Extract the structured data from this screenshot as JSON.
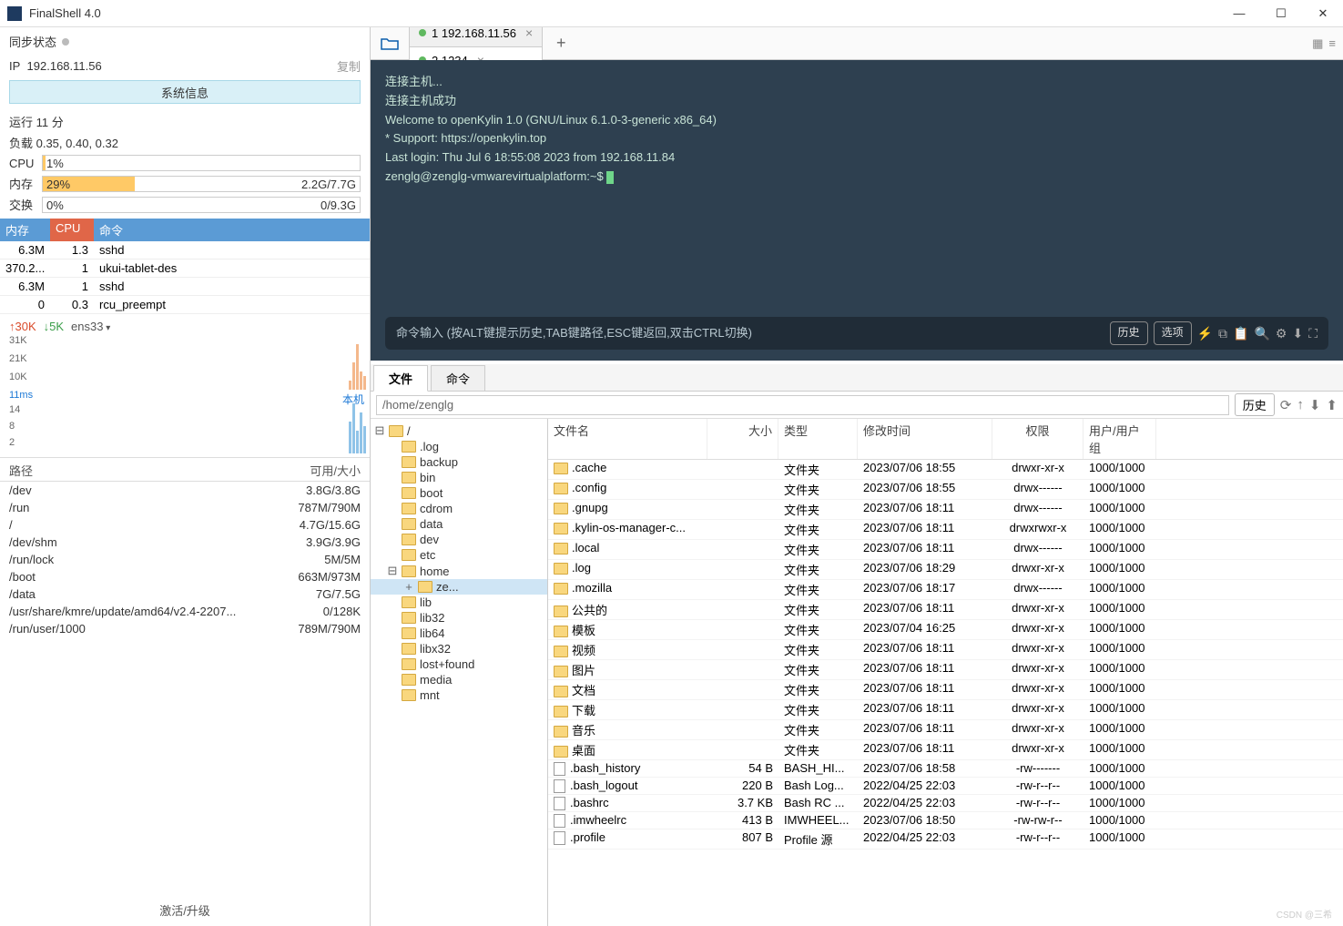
{
  "window": {
    "title": "FinalShell 4.0"
  },
  "left": {
    "sync": "同步状态",
    "ip_label": "IP",
    "ip": "192.168.11.56",
    "copy": "复制",
    "sysinfo_btn": "系统信息",
    "uptime": "运行 11 分",
    "load": "负载 0.35, 0.40, 0.32",
    "cpu": {
      "label": "CPU",
      "pct": "1%",
      "fill": 1
    },
    "mem": {
      "label": "内存",
      "pct": "29%",
      "right": "2.2G/7.7G",
      "fill": 29
    },
    "swap": {
      "label": "交换",
      "pct": "0%",
      "right": "0/9.3G",
      "fill": 0
    },
    "proc_head": {
      "mem": "内存",
      "cpu": "CPU",
      "cmd": "命令"
    },
    "procs": [
      {
        "mem": "6.3M",
        "cpu": "1.3",
        "cmd": "sshd"
      },
      {
        "mem": "370.2...",
        "cpu": "1",
        "cmd": "ukui-tablet-des"
      },
      {
        "mem": "6.3M",
        "cpu": "1",
        "cmd": "sshd"
      },
      {
        "mem": "0",
        "cpu": "0.3",
        "cmd": "rcu_preempt"
      }
    ],
    "net": {
      "up": "↑30K",
      "down": "↓5K",
      "iface": "ens33"
    },
    "chart1_y": [
      "31K",
      "21K",
      "10K"
    ],
    "chart2_y": [
      "11ms",
      "14",
      "8",
      "2"
    ],
    "chart2_label": "本机",
    "disk_head": {
      "path": "路径",
      "size": "可用/大小"
    },
    "disks": [
      {
        "path": "/dev",
        "size": "3.8G/3.8G",
        "fill": 0
      },
      {
        "path": "/run",
        "size": "787M/790M",
        "fill": 0
      },
      {
        "path": "/",
        "size": "4.7G/15.6G",
        "fill": 70
      },
      {
        "path": "/dev/shm",
        "size": "3.9G/3.9G",
        "fill": 0
      },
      {
        "path": "/run/lock",
        "size": "5M/5M",
        "fill": 0
      },
      {
        "path": "/boot",
        "size": "663M/973M",
        "fill": 32
      },
      {
        "path": "/data",
        "size": "7G/7.5G",
        "fill": 7
      },
      {
        "path": "/usr/share/kmre/update/amd64/v2.4-2207...",
        "size": "0/128K",
        "fill": 100
      },
      {
        "path": "/run/user/1000",
        "size": "789M/790M",
        "fill": 0
      }
    ],
    "upgrade": "激活/升级"
  },
  "tabs": [
    {
      "label": "1 192.168.11.56",
      "active": false
    },
    {
      "label": "2 1234",
      "active": true
    }
  ],
  "terminal_lines": [
    "连接主机...",
    "连接主机成功",
    "Welcome to openKylin 1.0 (GNU/Linux 6.1.0-3-generic x86_64)",
    "",
    " * Support:        https://openkylin.top",
    "",
    "Last login: Thu Jul  6 18:55:08 2023 from 192.168.11.84",
    "zenglg@zenglg-vmwarevirtualplatform:~$ "
  ],
  "term_hint": "命令输入 (按ALT键提示历史,TAB键路径,ESC键返回,双击CTRL切换)",
  "term_btns": {
    "history": "历史",
    "options": "选项"
  },
  "btabs": {
    "file": "文件",
    "cmd": "命令"
  },
  "path": "/home/zenglg",
  "path_history": "历史",
  "tree": [
    {
      "lvl": 0,
      "name": "/",
      "open": true
    },
    {
      "lvl": 1,
      "name": ".log"
    },
    {
      "lvl": 1,
      "name": "backup"
    },
    {
      "lvl": 1,
      "name": "bin"
    },
    {
      "lvl": 1,
      "name": "boot"
    },
    {
      "lvl": 1,
      "name": "cdrom"
    },
    {
      "lvl": 1,
      "name": "data"
    },
    {
      "lvl": 1,
      "name": "dev"
    },
    {
      "lvl": 1,
      "name": "etc"
    },
    {
      "lvl": 1,
      "name": "home",
      "open": true
    },
    {
      "lvl": 2,
      "name": "ze...",
      "sel": true,
      "tgl": "+"
    },
    {
      "lvl": 1,
      "name": "lib"
    },
    {
      "lvl": 1,
      "name": "lib32"
    },
    {
      "lvl": 1,
      "name": "lib64"
    },
    {
      "lvl": 1,
      "name": "libx32"
    },
    {
      "lvl": 1,
      "name": "lost+found"
    },
    {
      "lvl": 1,
      "name": "media"
    },
    {
      "lvl": 1,
      "name": "mnt"
    }
  ],
  "fl_head": {
    "name": "文件名",
    "size": "大小",
    "type": "类型",
    "date": "修改时间",
    "perm": "权限",
    "user": "用户/用户组"
  },
  "files": [
    {
      "folder": true,
      "name": ".cache",
      "size": "",
      "type": "文件夹",
      "date": "2023/07/06 18:55",
      "perm": "drwxr-xr-x",
      "user": "1000/1000"
    },
    {
      "folder": true,
      "name": ".config",
      "size": "",
      "type": "文件夹",
      "date": "2023/07/06 18:55",
      "perm": "drwx------",
      "user": "1000/1000"
    },
    {
      "folder": true,
      "name": ".gnupg",
      "size": "",
      "type": "文件夹",
      "date": "2023/07/06 18:11",
      "perm": "drwx------",
      "user": "1000/1000"
    },
    {
      "folder": true,
      "name": ".kylin-os-manager-c...",
      "size": "",
      "type": "文件夹",
      "date": "2023/07/06 18:11",
      "perm": "drwxrwxr-x",
      "user": "1000/1000"
    },
    {
      "folder": true,
      "name": ".local",
      "size": "",
      "type": "文件夹",
      "date": "2023/07/06 18:11",
      "perm": "drwx------",
      "user": "1000/1000"
    },
    {
      "folder": true,
      "name": ".log",
      "size": "",
      "type": "文件夹",
      "date": "2023/07/06 18:29",
      "perm": "drwxr-xr-x",
      "user": "1000/1000"
    },
    {
      "folder": true,
      "name": ".mozilla",
      "size": "",
      "type": "文件夹",
      "date": "2023/07/06 18:17",
      "perm": "drwx------",
      "user": "1000/1000"
    },
    {
      "folder": true,
      "name": "公共的",
      "size": "",
      "type": "文件夹",
      "date": "2023/07/06 18:11",
      "perm": "drwxr-xr-x",
      "user": "1000/1000"
    },
    {
      "folder": true,
      "name": "模板",
      "size": "",
      "type": "文件夹",
      "date": "2023/07/04 16:25",
      "perm": "drwxr-xr-x",
      "user": "1000/1000"
    },
    {
      "folder": true,
      "name": "视频",
      "size": "",
      "type": "文件夹",
      "date": "2023/07/06 18:11",
      "perm": "drwxr-xr-x",
      "user": "1000/1000"
    },
    {
      "folder": true,
      "name": "图片",
      "size": "",
      "type": "文件夹",
      "date": "2023/07/06 18:11",
      "perm": "drwxr-xr-x",
      "user": "1000/1000"
    },
    {
      "folder": true,
      "name": "文档",
      "size": "",
      "type": "文件夹",
      "date": "2023/07/06 18:11",
      "perm": "drwxr-xr-x",
      "user": "1000/1000"
    },
    {
      "folder": true,
      "name": "下载",
      "size": "",
      "type": "文件夹",
      "date": "2023/07/06 18:11",
      "perm": "drwxr-xr-x",
      "user": "1000/1000"
    },
    {
      "folder": true,
      "name": "音乐",
      "size": "",
      "type": "文件夹",
      "date": "2023/07/06 18:11",
      "perm": "drwxr-xr-x",
      "user": "1000/1000"
    },
    {
      "folder": true,
      "name": "桌面",
      "size": "",
      "type": "文件夹",
      "date": "2023/07/06 18:11",
      "perm": "drwxr-xr-x",
      "user": "1000/1000"
    },
    {
      "folder": false,
      "name": ".bash_history",
      "size": "54 B",
      "type": "BASH_HI...",
      "date": "2023/07/06 18:58",
      "perm": "-rw-------",
      "user": "1000/1000"
    },
    {
      "folder": false,
      "name": ".bash_logout",
      "size": "220 B",
      "type": "Bash Log...",
      "date": "2022/04/25 22:03",
      "perm": "-rw-r--r--",
      "user": "1000/1000"
    },
    {
      "folder": false,
      "name": ".bashrc",
      "size": "3.7 KB",
      "type": "Bash RC ...",
      "date": "2022/04/25 22:03",
      "perm": "-rw-r--r--",
      "user": "1000/1000"
    },
    {
      "folder": false,
      "name": ".imwheelrc",
      "size": "413 B",
      "type": "IMWHEEL...",
      "date": "2023/07/06 18:50",
      "perm": "-rw-rw-r--",
      "user": "1000/1000"
    },
    {
      "folder": false,
      "name": ".profile",
      "size": "807 B",
      "type": "Profile 源",
      "date": "2022/04/25 22:03",
      "perm": "-rw-r--r--",
      "user": "1000/1000"
    }
  ],
  "watermark": "CSDN @三希"
}
